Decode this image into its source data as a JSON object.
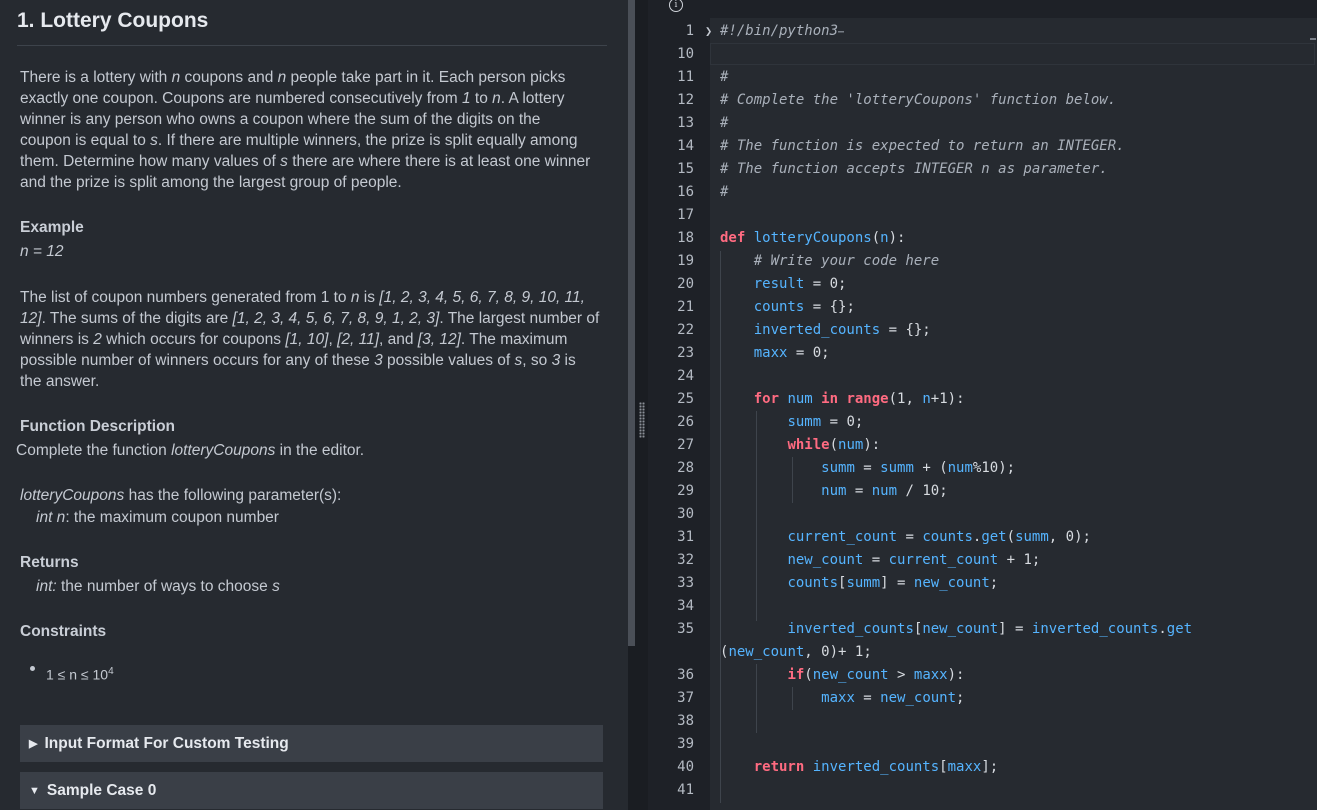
{
  "problem": {
    "title": "1. Lottery Coupons",
    "intro": [
      [
        "There is a lottery with ",
        {
          "i": "n"
        },
        " coupons and ",
        {
          "i": "n"
        },
        " people take part in it. Each person picks"
      ],
      [
        "exactly one coupon. Coupons are numbered consecutively from ",
        {
          "i": "1"
        },
        " to ",
        {
          "i": "n"
        },
        ". A lottery"
      ],
      [
        "winner is any person who owns a coupon where the sum of the digits on the"
      ],
      [
        "coupon is equal to ",
        {
          "i": "s"
        },
        ". If there are multiple winners, the prize is split equally among"
      ],
      [
        "them. Determine how many values of ",
        {
          "i": "s"
        },
        " there are where there is at least one winner"
      ],
      [
        "and the prize is split among the largest group of people."
      ]
    ],
    "example_heading": "Example",
    "example_value": "n = 12",
    "explanation": [
      [
        "The list of coupon numbers generated from 1 to ",
        {
          "i": "n"
        },
        " is ",
        {
          "i": "[1, 2, 3, 4, 5, 6, 7, 8, 9, 10, 11,"
        }
      ],
      [
        {
          "i": "12]"
        },
        ". The sums of the digits are ",
        {
          "i": "[1, 2, 3, 4, 5, 6, 7, 8, 9, 1, 2, 3]"
        },
        ". The largest number of"
      ],
      [
        "winners is ",
        {
          "i": "2"
        },
        " which occurs for coupons ",
        {
          "i": "[1, 10]"
        },
        ", ",
        {
          "i": "[2, 11]"
        },
        ", and ",
        {
          "i": "[3, 12]"
        },
        ". The maximum"
      ],
      [
        "possible number of winners occurs for any of these ",
        {
          "i": "3"
        },
        " possible values of ",
        {
          "i": "s"
        },
        ", so ",
        {
          "i": "3"
        },
        " is"
      ],
      [
        "the answer."
      ]
    ],
    "function_heading": "Function Description",
    "function_text": [
      [
        "Complete the function ",
        {
          "i": "lotteryCoupons"
        },
        " in the editor."
      ]
    ],
    "params_intro": [
      [
        {
          "i": "lotteryCoupons"
        },
        " has the following parameter(s):"
      ]
    ],
    "param_line": [
      [
        {
          "i": "int n"
        },
        ": the maximum coupon number"
      ]
    ],
    "returns_heading": "Returns",
    "returns_line": [
      [
        {
          "i": "int:"
        },
        " the number of ways to choose ",
        {
          "i": "s"
        }
      ]
    ],
    "constraints_heading": "Constraints",
    "constraint_base": "1 ≤ n ≤ 10",
    "constraint_exp": "4",
    "accordions": [
      {
        "label": "Input Format For Custom Testing",
        "state": "collapsed"
      },
      {
        "label": "Sample Case 0",
        "state": "expanded"
      }
    ]
  },
  "editor": {
    "info_icon": "info-icon",
    "lines": [
      {
        "n": "1",
        "fold": "❯",
        "t": [
          [
            "cm",
            "#!/bin/python3"
          ]
        ],
        "ellipsis": "⋯"
      },
      {
        "n": "10",
        "t": []
      },
      {
        "n": "11",
        "t": [
          [
            "cm",
            "#"
          ]
        ]
      },
      {
        "n": "12",
        "t": [
          [
            "cm",
            "# Complete the 'lotteryCoupons' function below."
          ]
        ]
      },
      {
        "n": "13",
        "t": [
          [
            "cm",
            "#"
          ]
        ]
      },
      {
        "n": "14",
        "t": [
          [
            "cm",
            "# The function is expected to return an INTEGER."
          ]
        ]
      },
      {
        "n": "15",
        "t": [
          [
            "cm",
            "# The function accepts INTEGER n as parameter."
          ]
        ]
      },
      {
        "n": "16",
        "t": [
          [
            "cm",
            "#"
          ]
        ]
      },
      {
        "n": "17",
        "t": []
      },
      {
        "n": "18",
        "t": [
          [
            "kw",
            "def "
          ],
          [
            "fn",
            "lotteryCoupons"
          ],
          [
            "pl",
            "("
          ],
          [
            "var",
            "n"
          ],
          [
            "pl",
            "):"
          ]
        ]
      },
      {
        "n": "19",
        "t": [
          [
            "pl",
            "    "
          ],
          [
            "cm",
            "# Write your code here"
          ]
        ]
      },
      {
        "n": "20",
        "t": [
          [
            "pl",
            "    "
          ],
          [
            "var",
            "result"
          ],
          [
            "op",
            " = "
          ],
          [
            "num",
            "0"
          ],
          [
            "pl",
            ";"
          ]
        ]
      },
      {
        "n": "21",
        "t": [
          [
            "pl",
            "    "
          ],
          [
            "var",
            "counts"
          ],
          [
            "op",
            " = "
          ],
          [
            "pl",
            "{};"
          ]
        ]
      },
      {
        "n": "22",
        "t": [
          [
            "pl",
            "    "
          ],
          [
            "var",
            "inverted_counts"
          ],
          [
            "op",
            " = "
          ],
          [
            "pl",
            "{};"
          ]
        ]
      },
      {
        "n": "23",
        "t": [
          [
            "pl",
            "    "
          ],
          [
            "var",
            "maxx"
          ],
          [
            "op",
            " = "
          ],
          [
            "num",
            "0"
          ],
          [
            "pl",
            ";"
          ]
        ]
      },
      {
        "n": "24",
        "t": []
      },
      {
        "n": "25",
        "t": [
          [
            "pl",
            "    "
          ],
          [
            "kw",
            "for "
          ],
          [
            "var",
            "num "
          ],
          [
            "kw",
            "in "
          ],
          [
            "kw",
            "range"
          ],
          [
            "pl",
            "("
          ],
          [
            "num",
            "1"
          ],
          [
            "pl",
            ", "
          ],
          [
            "var",
            "n"
          ],
          [
            "op",
            "+"
          ],
          [
            "num",
            "1"
          ],
          [
            "pl",
            "):"
          ]
        ]
      },
      {
        "n": "26",
        "t": [
          [
            "pl",
            "        "
          ],
          [
            "var",
            "summ"
          ],
          [
            "op",
            " = "
          ],
          [
            "num",
            "0"
          ],
          [
            "pl",
            ";"
          ]
        ]
      },
      {
        "n": "27",
        "t": [
          [
            "pl",
            "        "
          ],
          [
            "kw",
            "while"
          ],
          [
            "pl",
            "("
          ],
          [
            "var",
            "num"
          ],
          [
            "pl",
            "):"
          ]
        ]
      },
      {
        "n": "28",
        "t": [
          [
            "pl",
            "            "
          ],
          [
            "var",
            "summ"
          ],
          [
            "op",
            " = "
          ],
          [
            "var",
            "summ"
          ],
          [
            "op",
            " + "
          ],
          [
            "pl",
            "("
          ],
          [
            "var",
            "num"
          ],
          [
            "op",
            "%"
          ],
          [
            "num",
            "10"
          ],
          [
            "pl",
            ");"
          ]
        ]
      },
      {
        "n": "29",
        "t": [
          [
            "pl",
            "            "
          ],
          [
            "var",
            "num"
          ],
          [
            "op",
            " = "
          ],
          [
            "var",
            "num"
          ],
          [
            "op",
            " / "
          ],
          [
            "num",
            "10"
          ],
          [
            "pl",
            ";"
          ]
        ]
      },
      {
        "n": "30",
        "t": []
      },
      {
        "n": "31",
        "t": [
          [
            "pl",
            "        "
          ],
          [
            "var",
            "current_count"
          ],
          [
            "op",
            " = "
          ],
          [
            "var",
            "counts"
          ],
          [
            "pl",
            "."
          ],
          [
            "fn",
            "get"
          ],
          [
            "pl",
            "("
          ],
          [
            "var",
            "summ"
          ],
          [
            "pl",
            ", "
          ],
          [
            "num",
            "0"
          ],
          [
            "pl",
            ");"
          ]
        ]
      },
      {
        "n": "32",
        "t": [
          [
            "pl",
            "        "
          ],
          [
            "var",
            "new_count"
          ],
          [
            "op",
            " = "
          ],
          [
            "var",
            "current_count"
          ],
          [
            "op",
            " + "
          ],
          [
            "num",
            "1"
          ],
          [
            "pl",
            ";"
          ]
        ]
      },
      {
        "n": "33",
        "t": [
          [
            "pl",
            "        "
          ],
          [
            "var",
            "counts"
          ],
          [
            "pl",
            "["
          ],
          [
            "var",
            "summ"
          ],
          [
            "pl",
            "]"
          ],
          [
            "op",
            " = "
          ],
          [
            "var",
            "new_count"
          ],
          [
            "pl",
            ";"
          ]
        ]
      },
      {
        "n": "34",
        "t": []
      },
      {
        "n": "35",
        "t": [
          [
            "pl",
            "        "
          ],
          [
            "var",
            "inverted_counts"
          ],
          [
            "pl",
            "["
          ],
          [
            "var",
            "new_count"
          ],
          [
            "pl",
            "]"
          ],
          [
            "op",
            " = "
          ],
          [
            "var",
            "inverted_counts"
          ],
          [
            "pl",
            "."
          ],
          [
            "fn",
            "get"
          ]
        ]
      },
      {
        "n": "",
        "t": [
          [
            "pl",
            "("
          ],
          [
            "var",
            "new_count"
          ],
          [
            "pl",
            ", "
          ],
          [
            "num",
            "0"
          ],
          [
            "pl",
            ")"
          ],
          [
            "op",
            "+ "
          ],
          [
            "num",
            "1"
          ],
          [
            "pl",
            ";"
          ]
        ]
      },
      {
        "n": "36",
        "t": [
          [
            "pl",
            "        "
          ],
          [
            "kw",
            "if"
          ],
          [
            "pl",
            "("
          ],
          [
            "var",
            "new_count"
          ],
          [
            "op",
            " > "
          ],
          [
            "var",
            "maxx"
          ],
          [
            "pl",
            "):"
          ]
        ]
      },
      {
        "n": "37",
        "t": [
          [
            "pl",
            "            "
          ],
          [
            "var",
            "maxx"
          ],
          [
            "op",
            " = "
          ],
          [
            "var",
            "new_count"
          ],
          [
            "pl",
            ";"
          ]
        ]
      },
      {
        "n": "38",
        "t": []
      },
      {
        "n": "39",
        "t": []
      },
      {
        "n": "40",
        "t": [
          [
            "pl",
            "    "
          ],
          [
            "kw",
            "return "
          ],
          [
            "var",
            "inverted_counts"
          ],
          [
            "pl",
            "["
          ],
          [
            "var",
            "maxx"
          ],
          [
            "pl",
            "];"
          ]
        ]
      },
      {
        "n": "41",
        "t": []
      }
    ]
  }
}
